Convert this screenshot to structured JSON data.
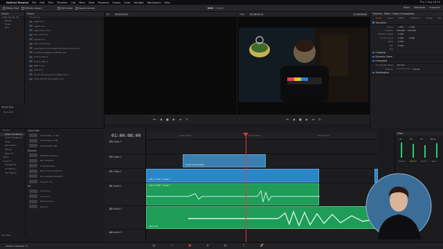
{
  "mac_menu": {
    "app": "DaVinci Resolve",
    "items": [
      "File",
      "Edit",
      "Trim",
      "Timeline",
      "Clip",
      "Mark",
      "View",
      "Playback",
      "Fusion",
      "Color",
      "Fairlight",
      "Workspace",
      "Help"
    ],
    "clock": "Thu 1 Aug 16:15"
  },
  "toolbar": {
    "left": [
      "Media Pool",
      "Effects Library",
      "Edit Index",
      "Sound Library"
    ],
    "project": "DS3",
    "status": "Edited",
    "right": [
      "Mixer",
      "Metadata",
      "Inspector"
    ]
  },
  "pool": {
    "header": "Master",
    "items": [
      "2021_08_03_YB",
      "B-Rolls",
      "Music",
      "SFX"
    ],
    "smart_bins": "Smart Bins",
    "keywords": "Keywords"
  },
  "files": {
    "header": "Master",
    "sub": "Clip Name",
    "items": [
      "Light.mov",
      "Light2.mov",
      "Light_intro.mov",
      "Mix_1.40.mov",
      "Appia.mov",
      "Intro_cmd2.png",
      "preamble-divinci-editor-the-fusion-final.mov",
      "FrontPoint-tagline_1080HS.mov",
      "Fusion Clips 1",
      "Fusion Clips 2",
      "NRC1.mov",
      "Jobs.mov",
      "Shoot-this-sound-cool-effect.mov",
      "2021_08_03_YB_Angle1.mov"
    ]
  },
  "viewer": {
    "src_zoom": "Fit",
    "src_tc": "00:00:00:01",
    "rec_zoom": "79%",
    "rec_tc": "00:18:04:11",
    "rec_tc_right": "01:00:08:00"
  },
  "inspector": {
    "header": "Timeline - Effect - Fusion Composition",
    "tabs": [
      "Video",
      "Audio",
      "Effect",
      "Transition",
      "Image",
      "File"
    ],
    "transform": "Transform",
    "params": [
      {
        "label": "Zoom",
        "x": "1.000",
        "y": "1.000"
      },
      {
        "label": "Position",
        "x": "636.000",
        "y": "220.000"
      },
      {
        "label": "Rotation Angle",
        "x": "0.000",
        "y": ""
      },
      {
        "label": "Anchor Point",
        "x": "0.000",
        "y": "0.000"
      },
      {
        "label": "Pitch",
        "x": "0.000",
        "y": ""
      },
      {
        "label": "Yaw",
        "x": "0.000",
        "y": ""
      },
      {
        "label": "Flip",
        "x": "",
        "y": ""
      }
    ],
    "sections": [
      "Cropping",
      "Dynamic Zoom",
      "Composite",
      "Stabilization"
    ],
    "composite_mode": "Normal",
    "opacity": "100.00"
  },
  "effects": {
    "tree": [
      "Toolbox",
      "Video Transitions",
      "Audio Transitions",
      "Titles",
      "Generators",
      "Effects",
      "Open FX",
      "Filters",
      "Audio FX",
      "Fairlight FX",
      "AU Effects",
      "VST Effects"
    ],
    "favorites": "Favorites",
    "cat1": "Cross Fade",
    "cat1_items": [
      "Cross Fade +3 dB",
      "Cross Fade -3 dB",
      "Cross Fade 0 dB"
    ],
    "cat2": "Dissolve",
    "cat2_items": [
      "Additive Dissolve",
      "Blur Dissolve",
      "Cross Dissolve",
      "Dip To Color Dissolve",
      "Non-Additive Dissolve",
      "Smooth Cut"
    ],
    "cat3": "Iris",
    "cat3_items": [
      "Arrow Iris",
      "Cross Iris",
      "Diamond Iris",
      "Eye Iris"
    ]
  },
  "timeline": {
    "timecode": "01:00:08:00",
    "ruler": [
      "01:00:00:00",
      "01:00:08:00",
      "01:00:16:00"
    ],
    "tracks": [
      {
        "name": "V3",
        "label": "Video 3"
      },
      {
        "name": "V2",
        "label": "Video 2"
      },
      {
        "name": "V1",
        "label": "Video 1"
      },
      {
        "name": "A1",
        "label": "Audio 1"
      },
      {
        "name": "A2",
        "label": "Audio 2"
      },
      {
        "name": "A3",
        "label": "Audio 3"
      }
    ],
    "clip_fusion": "Fusion Composition",
    "clip_v1": "2021_Y2.MH - Angle 1",
    "clip_a1": "2021_Y2.MH - Angle 1",
    "clip_a2": "light intro"
  },
  "mixer": {
    "header": "Mixer",
    "channels": [
      "A1",
      "A2",
      "A3",
      "Bus1"
    ],
    "labels": [
      "Audio 1",
      "Audio 2",
      "Audio 3",
      "Bus 1"
    ]
  },
  "bottom": {
    "brand": "DaVinci Resolve 17"
  }
}
